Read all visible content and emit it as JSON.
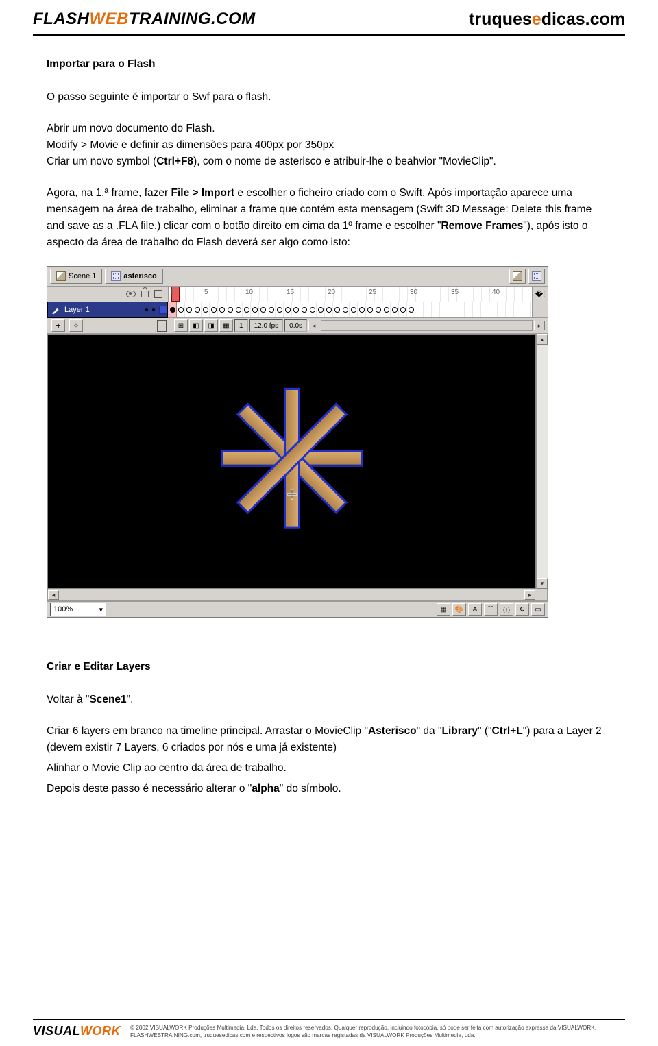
{
  "header": {
    "logo_left_a": "FLASH",
    "logo_left_b": "WEB",
    "logo_left_c": "TRAINING",
    "logo_left_d": ".COM",
    "logo_right_a": "truques",
    "logo_right_b": "e",
    "logo_right_c": "dicas.com"
  },
  "section1": {
    "title": "Importar para o Flash",
    "p1": "O passo seguinte é importar o Swf para o flash.",
    "p2a": "Abrir um novo documento do Flash.",
    "p2b": "Modify > Movie e definir as dimensões para 400px por 350px",
    "p2c_a": "Criar um novo symbol (",
    "p2c_b": "Ctrl+F8",
    "p2c_c": "), com o nome de asterisco e atribuir-lhe o beahvior \"MovieClip\".",
    "p3a": "Agora, na 1.ª frame, fazer ",
    "p3b": "File > Import",
    "p3c": " e escolher o ficheiro criado com o Swift. Após importação aparece uma mensagem na área de trabalho, eliminar a frame que contém esta mensagem (Swift 3D Message: Delete this frame and save as a .FLA file.) clicar com o botão direito em cima da 1º frame e escolher \"",
    "p3d": "Remove Frames",
    "p3e": "\"), após isto o aspecto da área de trabalho do Flash deverá ser algo como isto:"
  },
  "flash": {
    "scene": "Scene 1",
    "symbol": "asterisco",
    "layer": "Layer 1",
    "ruler": [
      "1",
      "5",
      "10",
      "15",
      "20",
      "25",
      "30",
      "35",
      "40"
    ],
    "status_frame": "1",
    "status_fps": "12.0 fps",
    "status_time": "0.0s",
    "zoom": "100%"
  },
  "section2": {
    "title": "Criar e Editar Layers",
    "p1a": "Voltar à \"",
    "p1b": "Scene1",
    "p1c": "\".",
    "p2a": "Criar 6 layers em branco na timeline principal. Arrastar o MovieClip \"",
    "p2b": "Asterisco",
    "p2c": "\" da \"",
    "p2d": "Library",
    "p2e": "\" (\"",
    "p2f": "Ctrl+L",
    "p2g": "\") para a Layer 2 (devem existir 7 Layers, 6 criados por nós e uma já existente)",
    "p3": "Alinhar o Movie Clip ao centro da área de trabalho.",
    "p4a": "Depois deste passo é necessário alterar o \"",
    "p4b": "alpha",
    "p4c": "\" do símbolo."
  },
  "footer": {
    "brand_a": "VISUAL",
    "brand_b": "WORK",
    "line1": "© 2002 VISUALWORK Produções Multimedia, Lda. Todos os direitos reservados. Qualquer reprodução, incluindo fotocópia, só pode ser feita com autorização expressa da VISUALWORK.",
    "line2": "FLASHWEBTRAINING.com, truquesedicas.com e respectivos logos são marcas registadas da VISUALWORK Produções Multimedia, Lda."
  }
}
